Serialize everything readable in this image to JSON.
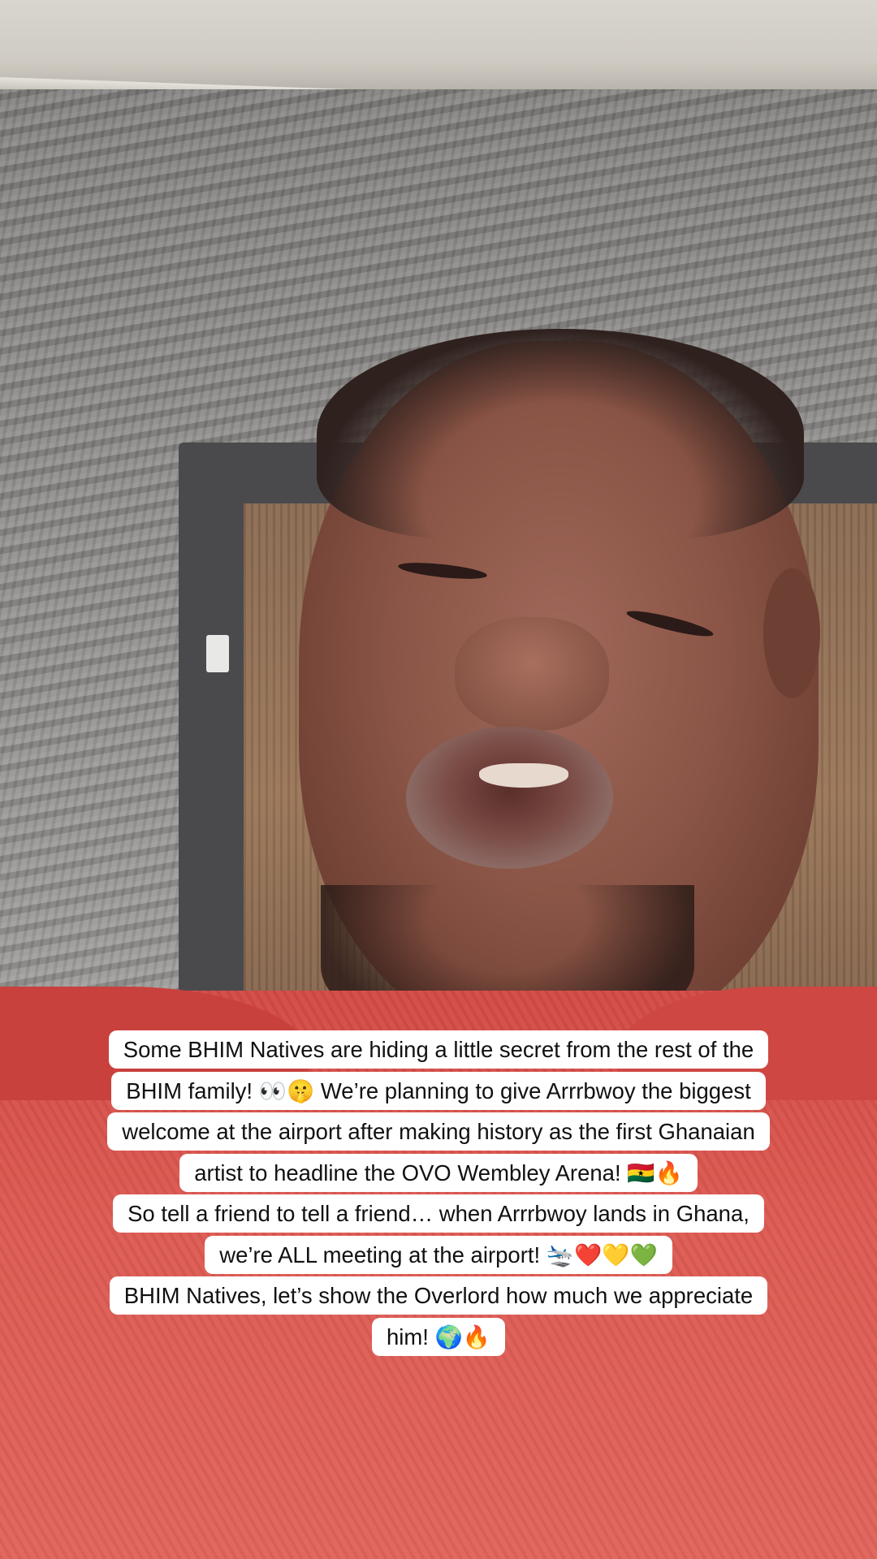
{
  "caption": {
    "lines": [
      "Some BHIM Natives are hiding a little secret from the rest of the",
      "BHIM family! 👀🤫 We’re planning to give Arrrbwoy the biggest",
      "welcome at the airport after making history as the first Ghanaian",
      "artist to headline the OVO Wembley Arena! 🇬🇭🔥",
      "So tell a friend to tell a friend… when Arrrbwoy lands in Ghana,",
      "we’re ALL meeting at the airport! 🛬❤️💛💚",
      "BHIM Natives, let’s show the Overlord how much we appreciate",
      "him! 🌍🔥"
    ]
  }
}
